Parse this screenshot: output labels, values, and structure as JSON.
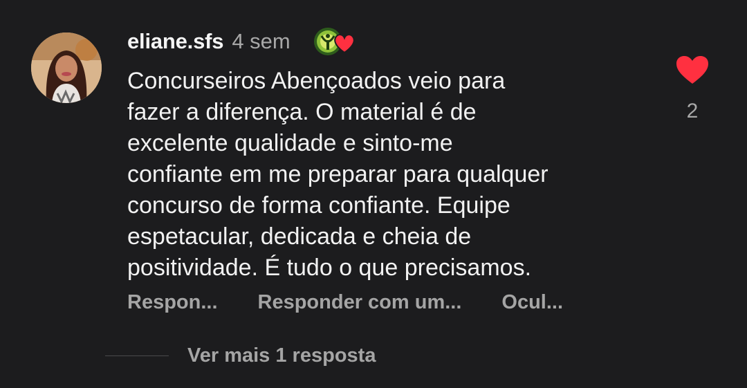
{
  "comment": {
    "username": "eliane.sfs",
    "time_ago": "4 sem",
    "badge_icon": "creator-liked-heart-icon",
    "text": "Concurseiros Abençoados veio para\nfazer a diferença. O material é de\nexcelente qualidade e  sinto-me\nconfiante em me preparar para qualquer\nconcurso de forma confiante. Equipe\nespetacular, dedicada e cheia de\npositividade.  É tudo o que precisamos.",
    "like_count": "2",
    "like_color": "#ff3040"
  },
  "actions": {
    "reply": "Respon...",
    "reply_with": "Responder com um...",
    "hide": "Ocul..."
  },
  "replies": {
    "more_label": "Ver mais 1 resposta"
  }
}
